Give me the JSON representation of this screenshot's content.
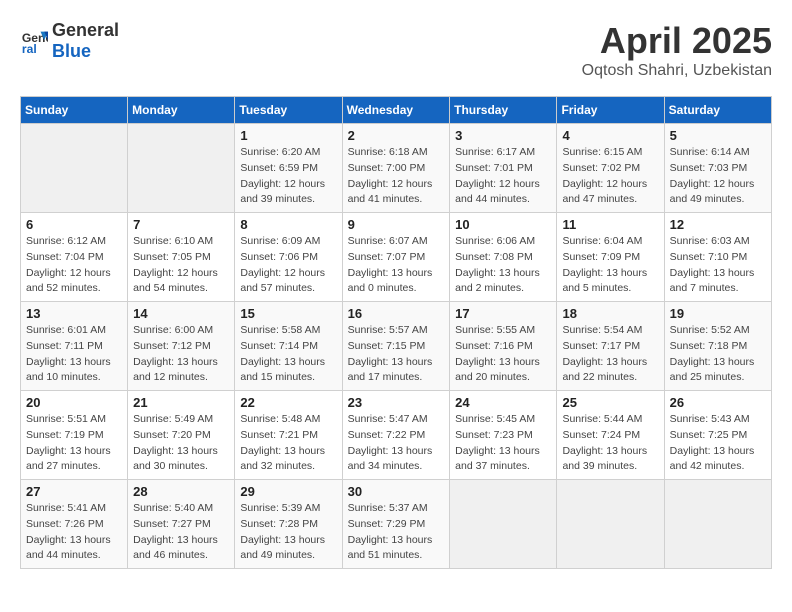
{
  "header": {
    "logo_general": "General",
    "logo_blue": "Blue",
    "title": "April 2025",
    "subtitle": "Oqtosh Shahri, Uzbekistan"
  },
  "weekdays": [
    "Sunday",
    "Monday",
    "Tuesday",
    "Wednesday",
    "Thursday",
    "Friday",
    "Saturday"
  ],
  "weeks": [
    [
      {
        "day": "",
        "sunrise": "",
        "sunset": "",
        "daylight": ""
      },
      {
        "day": "",
        "sunrise": "",
        "sunset": "",
        "daylight": ""
      },
      {
        "day": "1",
        "sunrise": "Sunrise: 6:20 AM",
        "sunset": "Sunset: 6:59 PM",
        "daylight": "Daylight: 12 hours and 39 minutes."
      },
      {
        "day": "2",
        "sunrise": "Sunrise: 6:18 AM",
        "sunset": "Sunset: 7:00 PM",
        "daylight": "Daylight: 12 hours and 41 minutes."
      },
      {
        "day": "3",
        "sunrise": "Sunrise: 6:17 AM",
        "sunset": "Sunset: 7:01 PM",
        "daylight": "Daylight: 12 hours and 44 minutes."
      },
      {
        "day": "4",
        "sunrise": "Sunrise: 6:15 AM",
        "sunset": "Sunset: 7:02 PM",
        "daylight": "Daylight: 12 hours and 47 minutes."
      },
      {
        "day": "5",
        "sunrise": "Sunrise: 6:14 AM",
        "sunset": "Sunset: 7:03 PM",
        "daylight": "Daylight: 12 hours and 49 minutes."
      }
    ],
    [
      {
        "day": "6",
        "sunrise": "Sunrise: 6:12 AM",
        "sunset": "Sunset: 7:04 PM",
        "daylight": "Daylight: 12 hours and 52 minutes."
      },
      {
        "day": "7",
        "sunrise": "Sunrise: 6:10 AM",
        "sunset": "Sunset: 7:05 PM",
        "daylight": "Daylight: 12 hours and 54 minutes."
      },
      {
        "day": "8",
        "sunrise": "Sunrise: 6:09 AM",
        "sunset": "Sunset: 7:06 PM",
        "daylight": "Daylight: 12 hours and 57 minutes."
      },
      {
        "day": "9",
        "sunrise": "Sunrise: 6:07 AM",
        "sunset": "Sunset: 7:07 PM",
        "daylight": "Daylight: 13 hours and 0 minutes."
      },
      {
        "day": "10",
        "sunrise": "Sunrise: 6:06 AM",
        "sunset": "Sunset: 7:08 PM",
        "daylight": "Daylight: 13 hours and 2 minutes."
      },
      {
        "day": "11",
        "sunrise": "Sunrise: 6:04 AM",
        "sunset": "Sunset: 7:09 PM",
        "daylight": "Daylight: 13 hours and 5 minutes."
      },
      {
        "day": "12",
        "sunrise": "Sunrise: 6:03 AM",
        "sunset": "Sunset: 7:10 PM",
        "daylight": "Daylight: 13 hours and 7 minutes."
      }
    ],
    [
      {
        "day": "13",
        "sunrise": "Sunrise: 6:01 AM",
        "sunset": "Sunset: 7:11 PM",
        "daylight": "Daylight: 13 hours and 10 minutes."
      },
      {
        "day": "14",
        "sunrise": "Sunrise: 6:00 AM",
        "sunset": "Sunset: 7:12 PM",
        "daylight": "Daylight: 13 hours and 12 minutes."
      },
      {
        "day": "15",
        "sunrise": "Sunrise: 5:58 AM",
        "sunset": "Sunset: 7:14 PM",
        "daylight": "Daylight: 13 hours and 15 minutes."
      },
      {
        "day": "16",
        "sunrise": "Sunrise: 5:57 AM",
        "sunset": "Sunset: 7:15 PM",
        "daylight": "Daylight: 13 hours and 17 minutes."
      },
      {
        "day": "17",
        "sunrise": "Sunrise: 5:55 AM",
        "sunset": "Sunset: 7:16 PM",
        "daylight": "Daylight: 13 hours and 20 minutes."
      },
      {
        "day": "18",
        "sunrise": "Sunrise: 5:54 AM",
        "sunset": "Sunset: 7:17 PM",
        "daylight": "Daylight: 13 hours and 22 minutes."
      },
      {
        "day": "19",
        "sunrise": "Sunrise: 5:52 AM",
        "sunset": "Sunset: 7:18 PM",
        "daylight": "Daylight: 13 hours and 25 minutes."
      }
    ],
    [
      {
        "day": "20",
        "sunrise": "Sunrise: 5:51 AM",
        "sunset": "Sunset: 7:19 PM",
        "daylight": "Daylight: 13 hours and 27 minutes."
      },
      {
        "day": "21",
        "sunrise": "Sunrise: 5:49 AM",
        "sunset": "Sunset: 7:20 PM",
        "daylight": "Daylight: 13 hours and 30 minutes."
      },
      {
        "day": "22",
        "sunrise": "Sunrise: 5:48 AM",
        "sunset": "Sunset: 7:21 PM",
        "daylight": "Daylight: 13 hours and 32 minutes."
      },
      {
        "day": "23",
        "sunrise": "Sunrise: 5:47 AM",
        "sunset": "Sunset: 7:22 PM",
        "daylight": "Daylight: 13 hours and 34 minutes."
      },
      {
        "day": "24",
        "sunrise": "Sunrise: 5:45 AM",
        "sunset": "Sunset: 7:23 PM",
        "daylight": "Daylight: 13 hours and 37 minutes."
      },
      {
        "day": "25",
        "sunrise": "Sunrise: 5:44 AM",
        "sunset": "Sunset: 7:24 PM",
        "daylight": "Daylight: 13 hours and 39 minutes."
      },
      {
        "day": "26",
        "sunrise": "Sunrise: 5:43 AM",
        "sunset": "Sunset: 7:25 PM",
        "daylight": "Daylight: 13 hours and 42 minutes."
      }
    ],
    [
      {
        "day": "27",
        "sunrise": "Sunrise: 5:41 AM",
        "sunset": "Sunset: 7:26 PM",
        "daylight": "Daylight: 13 hours and 44 minutes."
      },
      {
        "day": "28",
        "sunrise": "Sunrise: 5:40 AM",
        "sunset": "Sunset: 7:27 PM",
        "daylight": "Daylight: 13 hours and 46 minutes."
      },
      {
        "day": "29",
        "sunrise": "Sunrise: 5:39 AM",
        "sunset": "Sunset: 7:28 PM",
        "daylight": "Daylight: 13 hours and 49 minutes."
      },
      {
        "day": "30",
        "sunrise": "Sunrise: 5:37 AM",
        "sunset": "Sunset: 7:29 PM",
        "daylight": "Daylight: 13 hours and 51 minutes."
      },
      {
        "day": "",
        "sunrise": "",
        "sunset": "",
        "daylight": ""
      },
      {
        "day": "",
        "sunrise": "",
        "sunset": "",
        "daylight": ""
      },
      {
        "day": "",
        "sunrise": "",
        "sunset": "",
        "daylight": ""
      }
    ]
  ]
}
